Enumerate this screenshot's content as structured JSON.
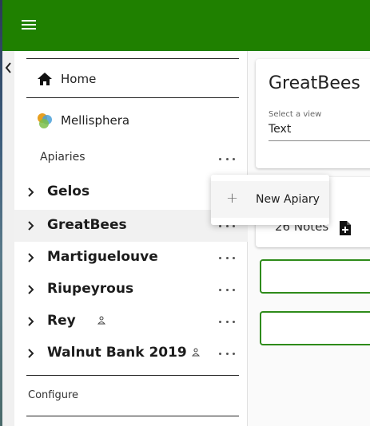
{
  "sidebar": {
    "nav": [
      {
        "label": "Home",
        "icon": "home-icon"
      },
      {
        "label": "Mellisphera",
        "icon": "mellisphera-logo-icon"
      }
    ],
    "section_label": "Apiaries",
    "apiaries": [
      {
        "name": "Gelos",
        "shared": false,
        "selected": false
      },
      {
        "name": "GreatBees",
        "shared": false,
        "selected": true
      },
      {
        "name": "Martiguelouve",
        "shared": false,
        "selected": false
      },
      {
        "name": "Riupeyrous",
        "shared": false,
        "selected": false
      },
      {
        "name": "Rey",
        "shared": true,
        "selected": false
      },
      {
        "name": "Walnut Bank 2019",
        "shared": true,
        "selected": false
      }
    ],
    "configure_label": "Configure"
  },
  "main": {
    "title": "GreatBees",
    "view_select": {
      "label": "Select a view",
      "value": "Text"
    },
    "notes_label": "26 Notes"
  },
  "popup_menu": {
    "items": [
      {
        "label": "New Apiary",
        "icon": "plus-icon"
      }
    ]
  },
  "colors": {
    "appbar": "#1f8000",
    "accent_green": "#2e8b1a"
  }
}
